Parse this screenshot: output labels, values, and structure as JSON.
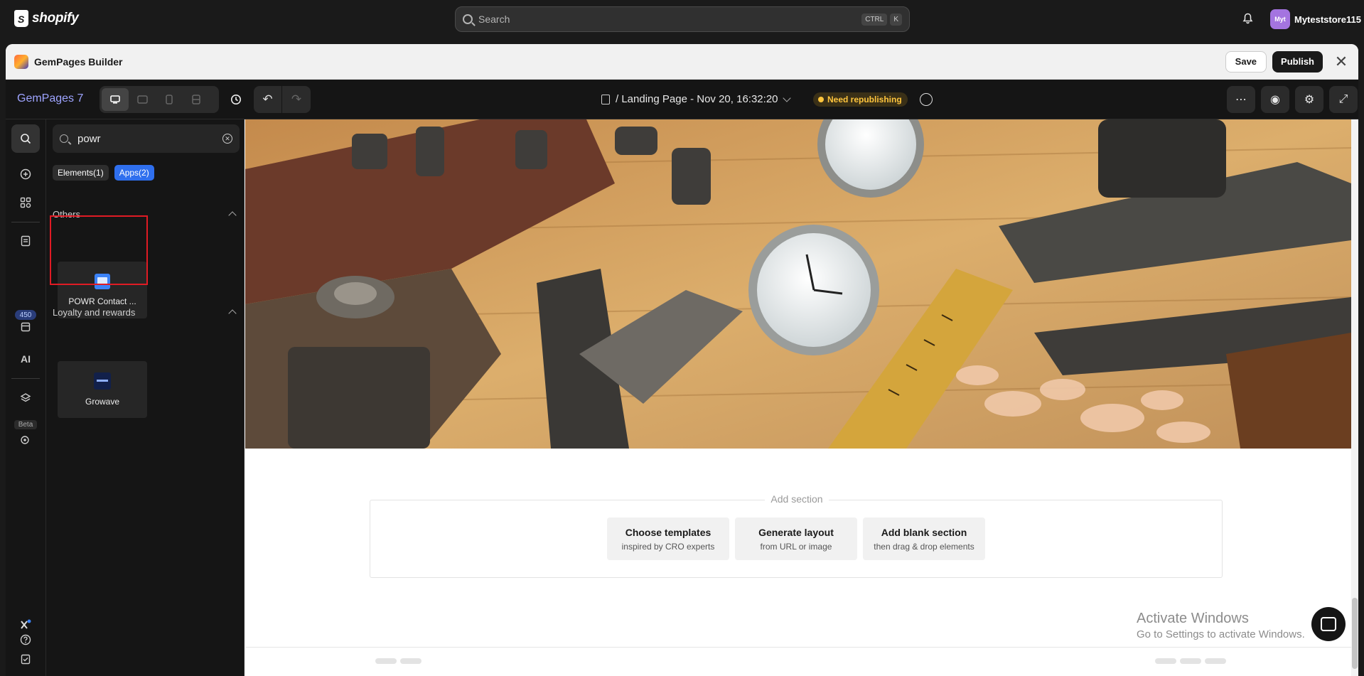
{
  "shopify": {
    "logo_text": "shopify",
    "search_placeholder": "Search",
    "shortcut_keys": [
      "CTRL",
      "K"
    ],
    "store_initials": "Myt",
    "store_name": "Myteststore115"
  },
  "modal": {
    "title": "GemPages Builder",
    "save_label": "Save",
    "publish_label": "Publish",
    "close_glyph": "✕"
  },
  "toolbar": {
    "app_name": "GemPages 7",
    "page_title": "/ Landing Page - Nov 20, 16:32:20",
    "status_badge": "Need republishing",
    "undo_glyph": "↶",
    "redo_glyph": "↷",
    "more_glyph": "⋯",
    "preview_glyph": "◉",
    "settings_glyph": "⚙",
    "expand_glyph": "⤢"
  },
  "rail": {
    "count_badge": "450",
    "ai_label": "AI",
    "beta_label": "Beta"
  },
  "panel": {
    "search_value": "powr",
    "tabs": [
      {
        "label": "Elements(1)",
        "active": false
      },
      {
        "label": "Apps(2)",
        "active": true
      }
    ],
    "groups": [
      {
        "title": "Others",
        "items": [
          {
            "label": "POWR Contact ..."
          }
        ]
      },
      {
        "title": "Loyalty and rewards",
        "items": [
          {
            "label": "Growave"
          }
        ]
      }
    ]
  },
  "canvas": {
    "add_section_title": "Add section",
    "options": [
      {
        "title": "Choose templates",
        "subtitle": "inspired by CRO experts"
      },
      {
        "title": "Generate layout",
        "subtitle": "from URL or image"
      },
      {
        "title": "Add blank section",
        "subtitle": "then drag & drop elements"
      }
    ],
    "watermark_line1": "Activate Windows",
    "watermark_line2": "Go to Settings to activate Windows."
  },
  "colors": {
    "accent": "#2f6fee",
    "badge": "#ffc53d",
    "highlight": "#e01b24"
  }
}
